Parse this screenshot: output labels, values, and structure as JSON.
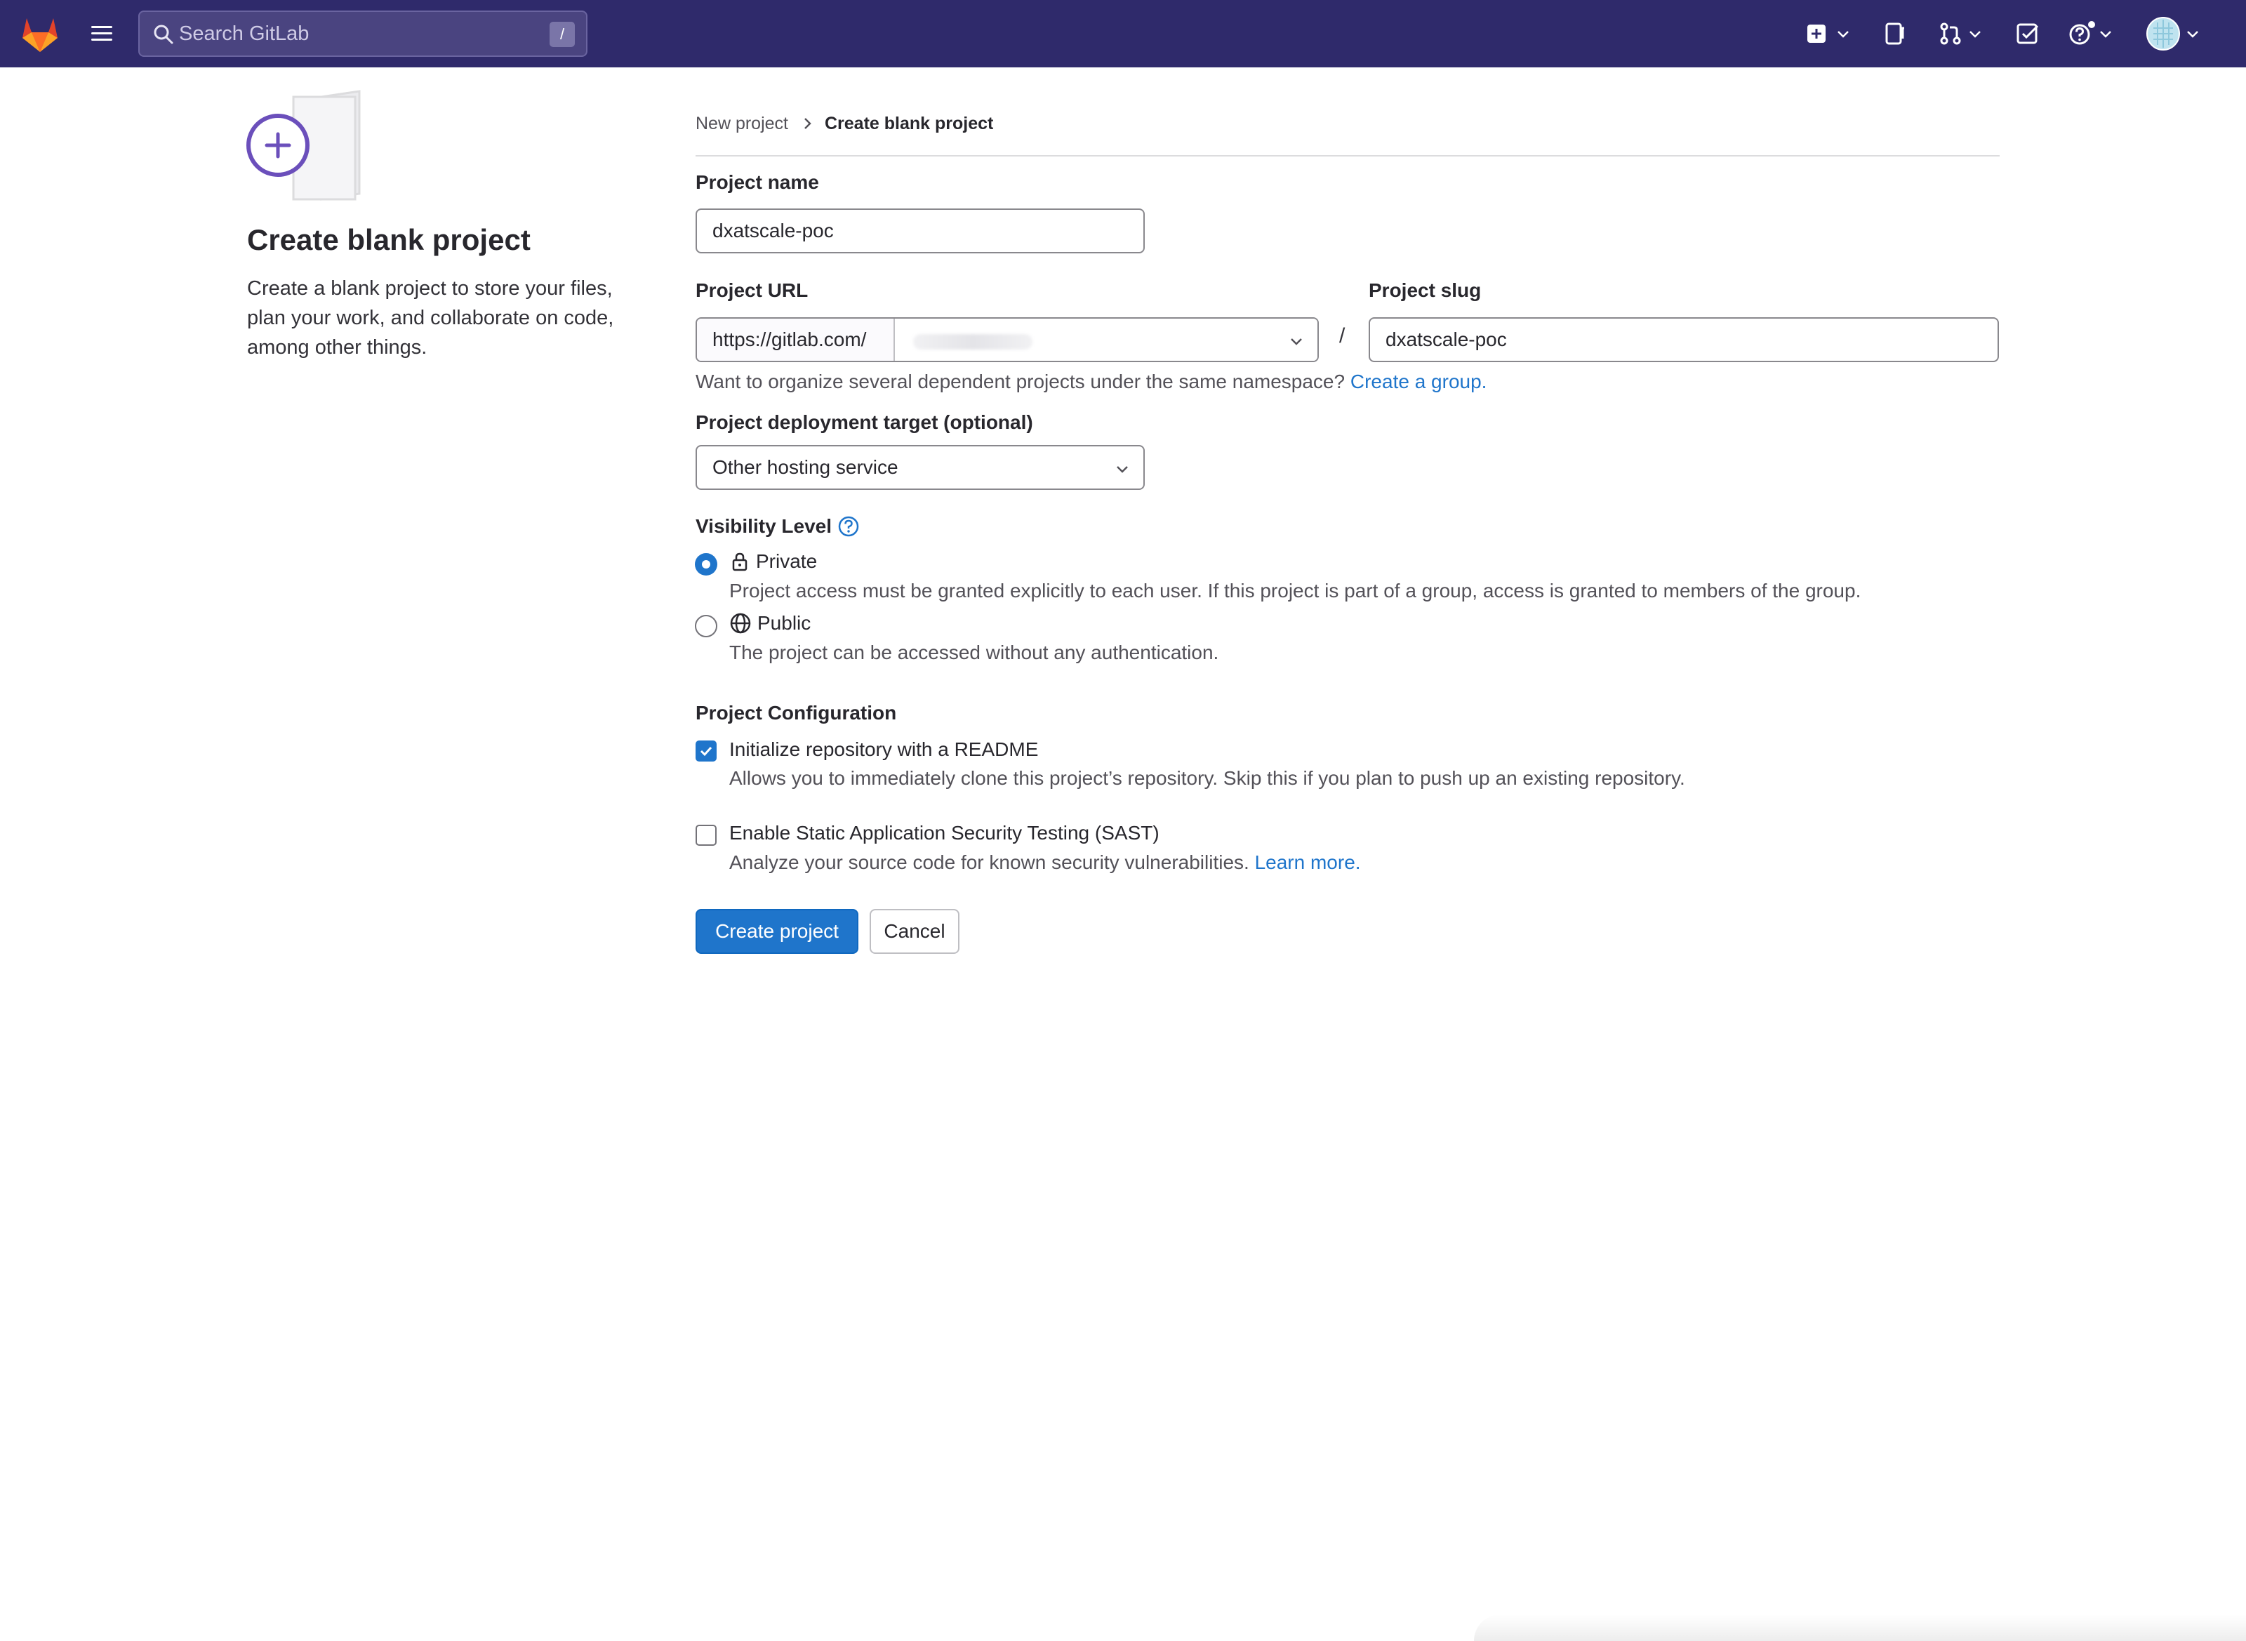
{
  "topbar": {
    "search_placeholder": "Search GitLab",
    "search_shortcut": "/",
    "brand_color": "#2f2a6b"
  },
  "left": {
    "title": "Create blank project",
    "description": "Create a blank project to store your files, plan your work, and collaborate on code, among other things."
  },
  "breadcrumb": {
    "parent": "New project",
    "current": "Create blank project"
  },
  "form": {
    "project_name_label": "Project name",
    "project_name_value": "dxatscale-poc",
    "project_url_label": "Project URL",
    "project_url_prefix": "https://gitlab.com/",
    "url_separator": "/",
    "project_slug_label": "Project slug",
    "project_slug_value": "dxatscale-poc",
    "namespace_hint": "Want to organize several dependent projects under the same namespace?",
    "namespace_hint_link": "Create a group.",
    "deployment_target_label": "Project deployment target (optional)",
    "deployment_target_value": "Other hosting service",
    "visibility_label": "Visibility Level",
    "visibility_options": [
      {
        "label": "Private",
        "description": "Project access must be granted explicitly to each user. If this project is part of a group, access is granted to members of the group.",
        "selected": true,
        "icon": "lock-icon"
      },
      {
        "label": "Public",
        "description": "The project can be accessed without any authentication.",
        "selected": false,
        "icon": "globe-icon"
      }
    ],
    "configuration_label": "Project Configuration",
    "readme_label": "Initialize repository with a README",
    "readme_description": "Allows you to immediately clone this project’s repository. Skip this if you plan to push up an existing repository.",
    "readme_checked": true,
    "sast_label": "Enable Static Application Security Testing (SAST)",
    "sast_description": "Analyze your source code for known security vulnerabilities.",
    "sast_link": "Learn more.",
    "sast_checked": false,
    "create_button": "Create project",
    "cancel_button": "Cancel"
  },
  "colors": {
    "primary": "#1f75cb",
    "link": "#1f75cb",
    "illustration_accent": "#6b4fbb"
  }
}
